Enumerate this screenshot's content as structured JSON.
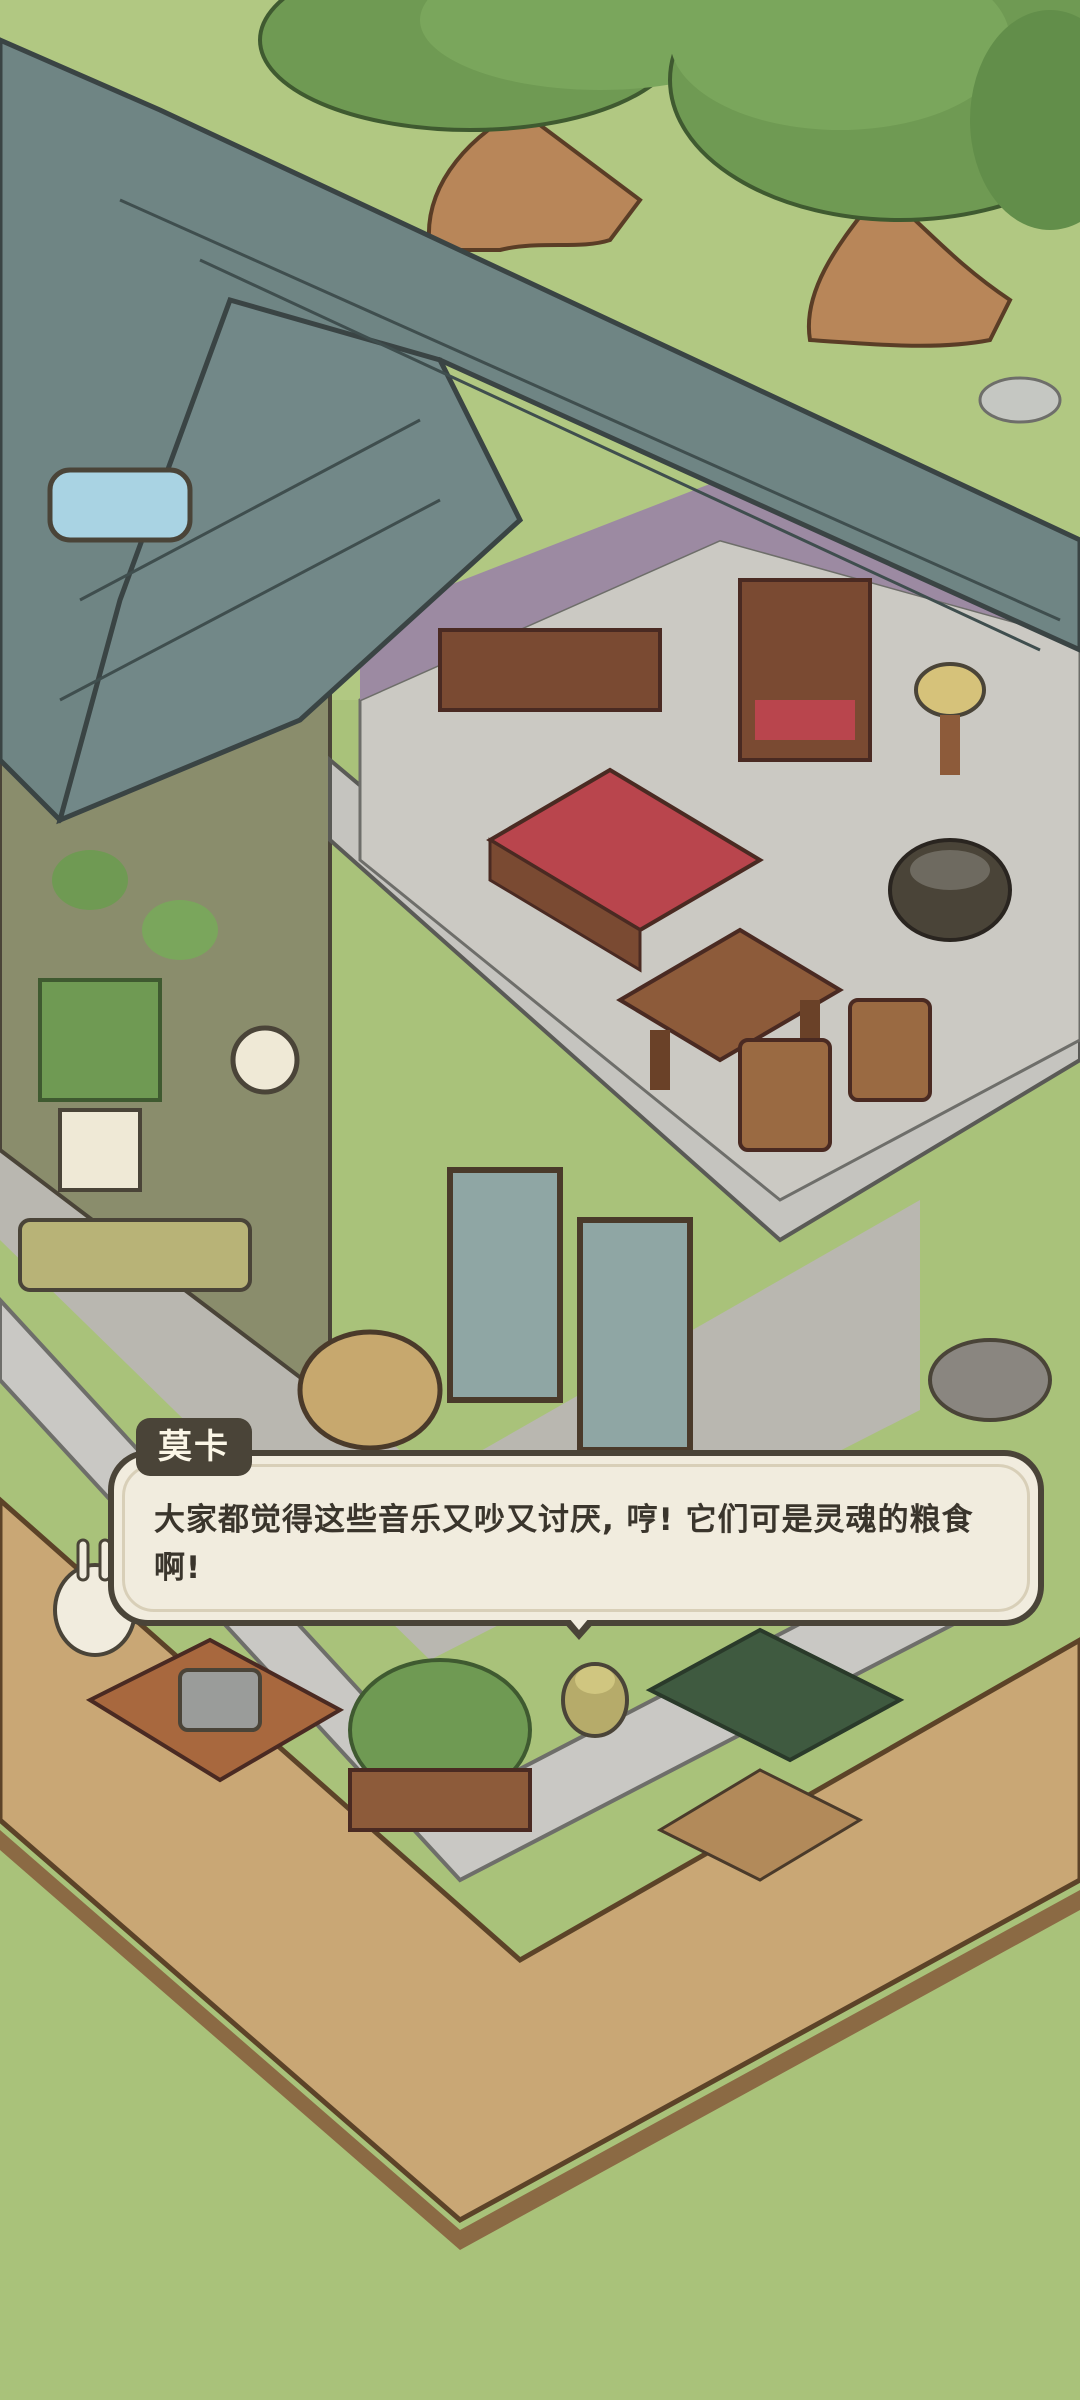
{
  "dialog": {
    "speaker": "莫卡",
    "text": "大家都觉得这些音乐又吵又讨厌, 哼! 它们可是灵魂的粮食啊!"
  },
  "colors": {
    "grass": "#a9c27a",
    "roof_tile": "#6f8584",
    "wood_floor": "#c9a775",
    "stone": "#c9c8c4",
    "dialog_bg": "#f1ecde",
    "dialog_border": "#4a4438"
  }
}
